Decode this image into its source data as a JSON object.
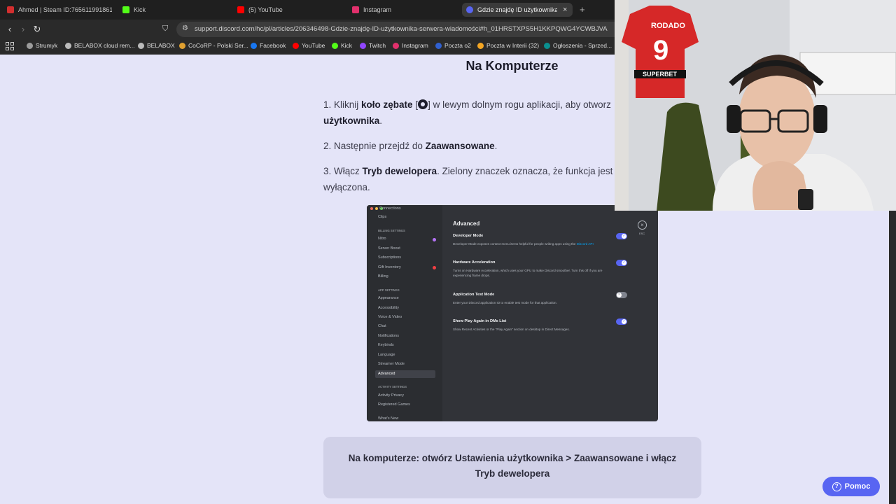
{
  "browser": {
    "tabs": [
      {
        "title": "Ahmed | Steam ID:7656119918616...",
        "color": "#d32f2f"
      },
      {
        "title": "Kick",
        "color": "#53fc18"
      },
      {
        "title": "(5) YouTube",
        "color": "#ff0000"
      },
      {
        "title": "Instagram",
        "color": "#e1306c"
      },
      {
        "title": "Gdzie znajdę ID użytkownika/ser...",
        "color": "#5865f2",
        "active": true
      }
    ],
    "new_tab": "+",
    "close": "×",
    "url": "support.discord.com/hc/pl/articles/206346498-Gdzie-znajdę-ID-użytkownika-serwera-wiadomości#h_01HRSTXPS5H1KKPQWG4YCWBJVA",
    "bookmarks": [
      {
        "label": "Strumyk",
        "color": "#9c9c9c"
      },
      {
        "label": "BELABOX cloud rem...",
        "color": "#bbbbbb"
      },
      {
        "label": "BELABOX",
        "color": "#bbbbbb"
      },
      {
        "label": "CoCoRP - Polski Ser...",
        "color": "#e0a030"
      },
      {
        "label": "Facebook",
        "color": "#1877f2"
      },
      {
        "label": "YouTube",
        "color": "#ff0000"
      },
      {
        "label": "Kick",
        "color": "#53fc18"
      },
      {
        "label": "Twitch",
        "color": "#9146ff"
      },
      {
        "label": "Instagram",
        "color": "#e1306c"
      },
      {
        "label": "Poczta o2",
        "color": "#3060d0"
      },
      {
        "label": "Poczta w Interii (32)",
        "color": "#f5a623"
      },
      {
        "label": "Ogłoszenia - Sprzed...",
        "color": "#0a8f8f"
      }
    ]
  },
  "article": {
    "heading": "Na Komputerze",
    "step1_a": "1. Kliknij ",
    "step1_b": "koło zębate",
    "step1_c": " [",
    "step1_d": "] w lewym dolnym rogu aplikacji, aby otworz",
    "step1_e": "użytkownika",
    "step1_f": ".",
    "step2_a": "2. Następnie przejdź do ",
    "step2_b": "Zaawansowane",
    "step2_c": ".",
    "step3_a": "3. Włącz ",
    "step3_b": "Tryb dewelopera",
    "step3_c": ". Zielony znaczek oznacza, że funkcja jest w",
    "step3_d": "wyłączona.",
    "summary": "Na komputerze: otwórz Ustawienia użytkownika > Zaawansowane i włącz Tryb dewelopera"
  },
  "discord": {
    "sidebar_top": "Connections",
    "clips": "Clips",
    "billing_header": "BILLING SETTINGS",
    "billing_items": [
      "Nitro",
      "Server Boost",
      "Subscriptions",
      "Gift Inventory",
      "Billing"
    ],
    "app_header": "APP SETTINGS",
    "app_items": [
      "Appearance",
      "Accessibility",
      "Voice & Video",
      "Chat",
      "Notifications",
      "Keybinds",
      "Language",
      "Streamer Mode",
      "Advanced"
    ],
    "activity_header": "ACTIVITY SETTINGS",
    "activity_items": [
      "Activity Privacy",
      "Registered Games"
    ],
    "whats_new": "What's New",
    "title": "Advanced",
    "esc": "ESC",
    "rows": [
      {
        "title": "Developer Mode",
        "desc": "Developer Mode exposes context menu items helpful for people writing apps using the ",
        "link": "Discord API",
        "on": true
      },
      {
        "title": "Hardware Acceleration",
        "desc": "Turns on Hardware Acceleration, which uses your GPU to make Discord smoother. Turn this off if you are experiencing frame drops.",
        "on": true
      },
      {
        "title": "Application Test Mode",
        "desc": "Enter your Discord application ID to enable test mode for that application.",
        "on": false
      },
      {
        "title": "Show Play Again in DMs List",
        "desc": "Show Recent Activities or the \"Play Again\" section on desktop in Direct Messages.",
        "on": true
      }
    ]
  },
  "help": {
    "label": "Pomoc"
  },
  "webcam": {
    "jersey_name": "RODADO",
    "jersey_number": "9",
    "jersey_sponsor": "SUPERBET"
  }
}
